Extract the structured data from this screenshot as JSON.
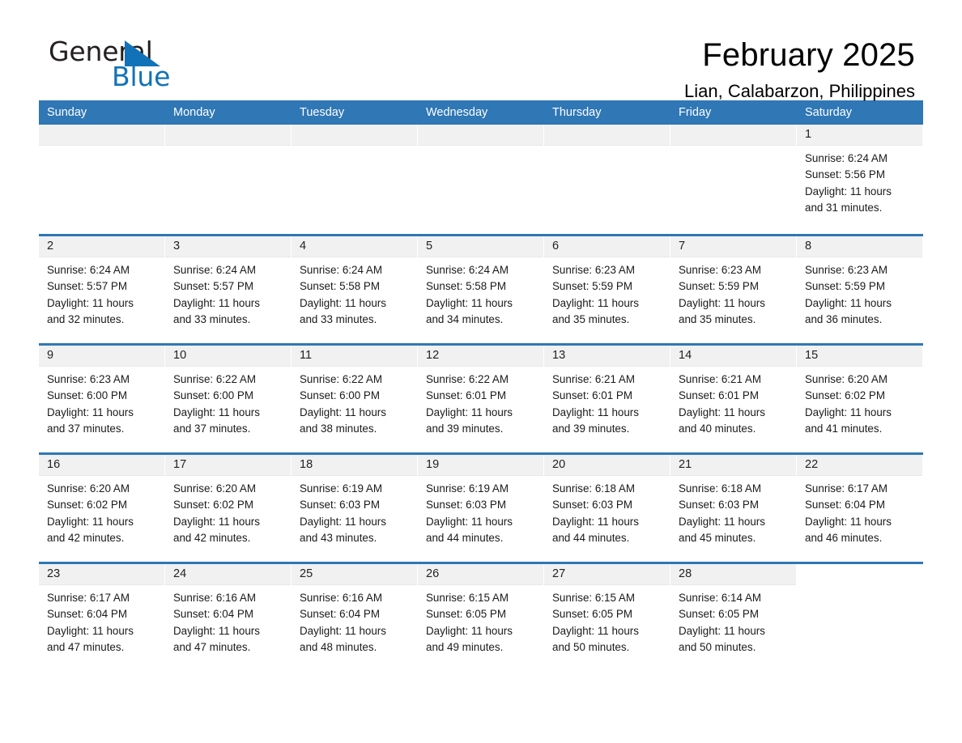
{
  "brand": {
    "name_part1": "General",
    "name_part2": "Blue",
    "triangle_color": "#1272b8"
  },
  "header": {
    "month_title": "February 2025",
    "location": "Lian, Calabarzon, Philippines"
  },
  "theme": {
    "header_blue": "#2f77b5",
    "day_band_gray": "#f1f1f1",
    "text_color": "#1a1a1a"
  },
  "weekdays": [
    "Sunday",
    "Monday",
    "Tuesday",
    "Wednesday",
    "Thursday",
    "Friday",
    "Saturday"
  ],
  "labels": {
    "sunrise_prefix": "Sunrise: ",
    "sunset_prefix": "Sunset: ",
    "daylight_prefix": "Daylight: "
  },
  "weeks": [
    [
      {
        "empty": true
      },
      {
        "empty": true
      },
      {
        "empty": true
      },
      {
        "empty": true
      },
      {
        "empty": true
      },
      {
        "empty": true
      },
      {
        "empty": false,
        "day": "1",
        "sunrise": "Sunrise: 6:24 AM",
        "sunset": "Sunset: 5:56 PM",
        "daylight_line1": "Daylight: 11 hours",
        "daylight_line2": "and 31 minutes."
      }
    ],
    [
      {
        "empty": false,
        "day": "2",
        "sunrise": "Sunrise: 6:24 AM",
        "sunset": "Sunset: 5:57 PM",
        "daylight_line1": "Daylight: 11 hours",
        "daylight_line2": "and 32 minutes."
      },
      {
        "empty": false,
        "day": "3",
        "sunrise": "Sunrise: 6:24 AM",
        "sunset": "Sunset: 5:57 PM",
        "daylight_line1": "Daylight: 11 hours",
        "daylight_line2": "and 33 minutes."
      },
      {
        "empty": false,
        "day": "4",
        "sunrise": "Sunrise: 6:24 AM",
        "sunset": "Sunset: 5:58 PM",
        "daylight_line1": "Daylight: 11 hours",
        "daylight_line2": "and 33 minutes."
      },
      {
        "empty": false,
        "day": "5",
        "sunrise": "Sunrise: 6:24 AM",
        "sunset": "Sunset: 5:58 PM",
        "daylight_line1": "Daylight: 11 hours",
        "daylight_line2": "and 34 minutes."
      },
      {
        "empty": false,
        "day": "6",
        "sunrise": "Sunrise: 6:23 AM",
        "sunset": "Sunset: 5:59 PM",
        "daylight_line1": "Daylight: 11 hours",
        "daylight_line2": "and 35 minutes."
      },
      {
        "empty": false,
        "day": "7",
        "sunrise": "Sunrise: 6:23 AM",
        "sunset": "Sunset: 5:59 PM",
        "daylight_line1": "Daylight: 11 hours",
        "daylight_line2": "and 35 minutes."
      },
      {
        "empty": false,
        "day": "8",
        "sunrise": "Sunrise: 6:23 AM",
        "sunset": "Sunset: 5:59 PM",
        "daylight_line1": "Daylight: 11 hours",
        "daylight_line2": "and 36 minutes."
      }
    ],
    [
      {
        "empty": false,
        "day": "9",
        "sunrise": "Sunrise: 6:23 AM",
        "sunset": "Sunset: 6:00 PM",
        "daylight_line1": "Daylight: 11 hours",
        "daylight_line2": "and 37 minutes."
      },
      {
        "empty": false,
        "day": "10",
        "sunrise": "Sunrise: 6:22 AM",
        "sunset": "Sunset: 6:00 PM",
        "daylight_line1": "Daylight: 11 hours",
        "daylight_line2": "and 37 minutes."
      },
      {
        "empty": false,
        "day": "11",
        "sunrise": "Sunrise: 6:22 AM",
        "sunset": "Sunset: 6:00 PM",
        "daylight_line1": "Daylight: 11 hours",
        "daylight_line2": "and 38 minutes."
      },
      {
        "empty": false,
        "day": "12",
        "sunrise": "Sunrise: 6:22 AM",
        "sunset": "Sunset: 6:01 PM",
        "daylight_line1": "Daylight: 11 hours",
        "daylight_line2": "and 39 minutes."
      },
      {
        "empty": false,
        "day": "13",
        "sunrise": "Sunrise: 6:21 AM",
        "sunset": "Sunset: 6:01 PM",
        "daylight_line1": "Daylight: 11 hours",
        "daylight_line2": "and 39 minutes."
      },
      {
        "empty": false,
        "day": "14",
        "sunrise": "Sunrise: 6:21 AM",
        "sunset": "Sunset: 6:01 PM",
        "daylight_line1": "Daylight: 11 hours",
        "daylight_line2": "and 40 minutes."
      },
      {
        "empty": false,
        "day": "15",
        "sunrise": "Sunrise: 6:20 AM",
        "sunset": "Sunset: 6:02 PM",
        "daylight_line1": "Daylight: 11 hours",
        "daylight_line2": "and 41 minutes."
      }
    ],
    [
      {
        "empty": false,
        "day": "16",
        "sunrise": "Sunrise: 6:20 AM",
        "sunset": "Sunset: 6:02 PM",
        "daylight_line1": "Daylight: 11 hours",
        "daylight_line2": "and 42 minutes."
      },
      {
        "empty": false,
        "day": "17",
        "sunrise": "Sunrise: 6:20 AM",
        "sunset": "Sunset: 6:02 PM",
        "daylight_line1": "Daylight: 11 hours",
        "daylight_line2": "and 42 minutes."
      },
      {
        "empty": false,
        "day": "18",
        "sunrise": "Sunrise: 6:19 AM",
        "sunset": "Sunset: 6:03 PM",
        "daylight_line1": "Daylight: 11 hours",
        "daylight_line2": "and 43 minutes."
      },
      {
        "empty": false,
        "day": "19",
        "sunrise": "Sunrise: 6:19 AM",
        "sunset": "Sunset: 6:03 PM",
        "daylight_line1": "Daylight: 11 hours",
        "daylight_line2": "and 44 minutes."
      },
      {
        "empty": false,
        "day": "20",
        "sunrise": "Sunrise: 6:18 AM",
        "sunset": "Sunset: 6:03 PM",
        "daylight_line1": "Daylight: 11 hours",
        "daylight_line2": "and 44 minutes."
      },
      {
        "empty": false,
        "day": "21",
        "sunrise": "Sunrise: 6:18 AM",
        "sunset": "Sunset: 6:03 PM",
        "daylight_line1": "Daylight: 11 hours",
        "daylight_line2": "and 45 minutes."
      },
      {
        "empty": false,
        "day": "22",
        "sunrise": "Sunrise: 6:17 AM",
        "sunset": "Sunset: 6:04 PM",
        "daylight_line1": "Daylight: 11 hours",
        "daylight_line2": "and 46 minutes."
      }
    ],
    [
      {
        "empty": false,
        "day": "23",
        "sunrise": "Sunrise: 6:17 AM",
        "sunset": "Sunset: 6:04 PM",
        "daylight_line1": "Daylight: 11 hours",
        "daylight_line2": "and 47 minutes."
      },
      {
        "empty": false,
        "day": "24",
        "sunrise": "Sunrise: 6:16 AM",
        "sunset": "Sunset: 6:04 PM",
        "daylight_line1": "Daylight: 11 hours",
        "daylight_line2": "and 47 minutes."
      },
      {
        "empty": false,
        "day": "25",
        "sunrise": "Sunrise: 6:16 AM",
        "sunset": "Sunset: 6:04 PM",
        "daylight_line1": "Daylight: 11 hours",
        "daylight_line2": "and 48 minutes."
      },
      {
        "empty": false,
        "day": "26",
        "sunrise": "Sunrise: 6:15 AM",
        "sunset": "Sunset: 6:05 PM",
        "daylight_line1": "Daylight: 11 hours",
        "daylight_line2": "and 49 minutes."
      },
      {
        "empty": false,
        "day": "27",
        "sunrise": "Sunrise: 6:15 AM",
        "sunset": "Sunset: 6:05 PM",
        "daylight_line1": "Daylight: 11 hours",
        "daylight_line2": "and 50 minutes."
      },
      {
        "empty": false,
        "day": "28",
        "sunrise": "Sunrise: 6:14 AM",
        "sunset": "Sunset: 6:05 PM",
        "daylight_line1": "Daylight: 11 hours",
        "daylight_line2": "and 50 minutes."
      },
      {
        "empty": true,
        "blank": true
      }
    ]
  ]
}
